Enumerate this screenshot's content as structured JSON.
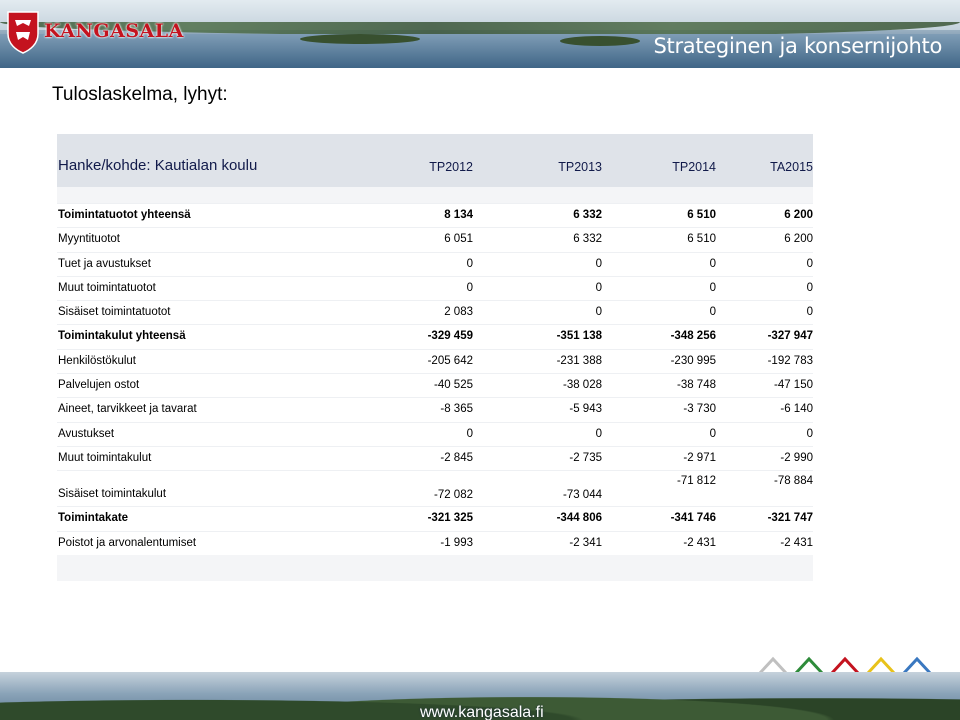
{
  "header": {
    "logo_text": "KANGASALA",
    "title": "Strateginen ja konsernijohto"
  },
  "page": {
    "title": "Tuloslaskelma, lyhyt:"
  },
  "table": {
    "project_label": "Hanke/kohde: Kautialan koulu",
    "columns": [
      "TP2012",
      "TP2013",
      "TP2014",
      "TA2015"
    ],
    "rows": [
      {
        "label": "Toimintatuotot yhteensä",
        "values": [
          "8 134",
          "6 332",
          "6 510",
          "6 200"
        ],
        "bold": true
      },
      {
        "label": "Myyntituotot",
        "values": [
          "6 051",
          "6 332",
          "6 510",
          "6 200"
        ]
      },
      {
        "label": "Tuet ja avustukset",
        "values": [
          "0",
          "0",
          "0",
          "0"
        ]
      },
      {
        "label": "Muut toimintatuotot",
        "values": [
          "0",
          "0",
          "0",
          "0"
        ]
      },
      {
        "label": "Sisäiset toimintatuotot",
        "values": [
          "2 083",
          "0",
          "0",
          "0"
        ]
      },
      {
        "label": "Toimintakulut yhteensä",
        "values": [
          "-329 459",
          "-351 138",
          "-348 256",
          "-327 947"
        ],
        "bold": true
      },
      {
        "label": "Henkilöstökulut",
        "values": [
          "-205 642",
          "-231 388",
          "-230 995",
          "-192 783"
        ]
      },
      {
        "label": "Palvelujen ostot",
        "values": [
          "-40 525",
          "-38 028",
          "-38 748",
          "-47 150"
        ]
      },
      {
        "label": "Aineet, tarvikkeet ja tavarat",
        "values": [
          "-8 365",
          "-5 943",
          "-3 730",
          "-6 140"
        ]
      },
      {
        "label": "Avustukset",
        "values": [
          "0",
          "0",
          "0",
          "0"
        ]
      },
      {
        "label": "Muut toimintakulut",
        "values": [
          "-2 845",
          "-2 735",
          "-2 971",
          "-2 990"
        ]
      },
      {
        "label": "Sisäiset toimintakulut",
        "values": [
          "-72 082",
          "-73 044",
          "-71 812",
          "-78 884"
        ]
      },
      {
        "label": "Toimintakate",
        "values": [
          "-321 325",
          "-344 806",
          "-341 746",
          "-321 747"
        ],
        "bold": true
      },
      {
        "label": "Poistot ja arvonalentumiset",
        "values": [
          "-1 993",
          "-2 341",
          "-2 431",
          "-2 431"
        ]
      }
    ]
  },
  "footer": {
    "url": "www.kangasala.fi",
    "triangle_colors": [
      "#c0c0c0",
      "#2e8b3a",
      "#c4131f",
      "#e8c21a",
      "#3a78c0"
    ]
  }
}
